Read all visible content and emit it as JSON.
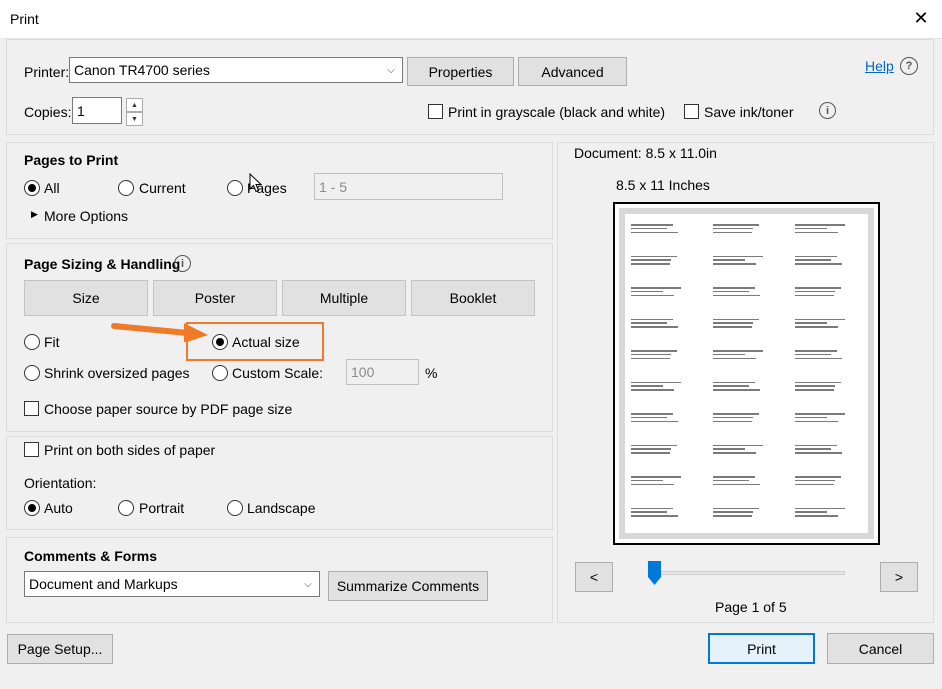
{
  "window": {
    "title": "Print"
  },
  "printer": {
    "label": "Printer:",
    "selected": "Canon TR4700 series",
    "properties_label": "Properties",
    "advanced_label": "Advanced",
    "help_label": "Help"
  },
  "copies": {
    "label": "Copies:",
    "value": "1"
  },
  "options": {
    "grayscale_label": "Print in grayscale (black and white)",
    "save_ink_label": "Save ink/toner"
  },
  "pages_to_print": {
    "heading": "Pages to Print",
    "all_label": "All",
    "current_label": "Current",
    "pages_label": "Pages",
    "pages_placeholder": "1 - 5",
    "more_options_label": "More Options"
  },
  "sizing": {
    "heading": "Page Sizing & Handling",
    "tabs": [
      "Size",
      "Poster",
      "Multiple",
      "Booklet"
    ],
    "fit_label": "Fit",
    "actual_label": "Actual size",
    "shrink_label": "Shrink oversized pages",
    "custom_label": "Custom Scale:",
    "custom_value": "100",
    "percent": "%",
    "paper_source_label": "Choose paper source by PDF page size"
  },
  "duplex": {
    "both_sides_label": "Print on both sides of paper",
    "orientation_label": "Orientation:",
    "auto_label": "Auto",
    "portrait_label": "Portrait",
    "landscape_label": "Landscape"
  },
  "comments": {
    "heading": "Comments & Forms",
    "selected": "Document and Markups",
    "summarize_label": "Summarize Comments"
  },
  "preview": {
    "document_size": "Document: 8.5 x 11.0in",
    "paper_size": "8.5 x 11 Inches",
    "prev_label": "<",
    "next_label": ">",
    "page_indicator": "Page 1 of 5",
    "slider_position": 0.0
  },
  "footer": {
    "page_setup_label": "Page Setup...",
    "print_label": "Print",
    "cancel_label": "Cancel"
  },
  "colors": {
    "accent": "#0078d7",
    "annotation": "#f07a28",
    "link": "#0066cc"
  }
}
